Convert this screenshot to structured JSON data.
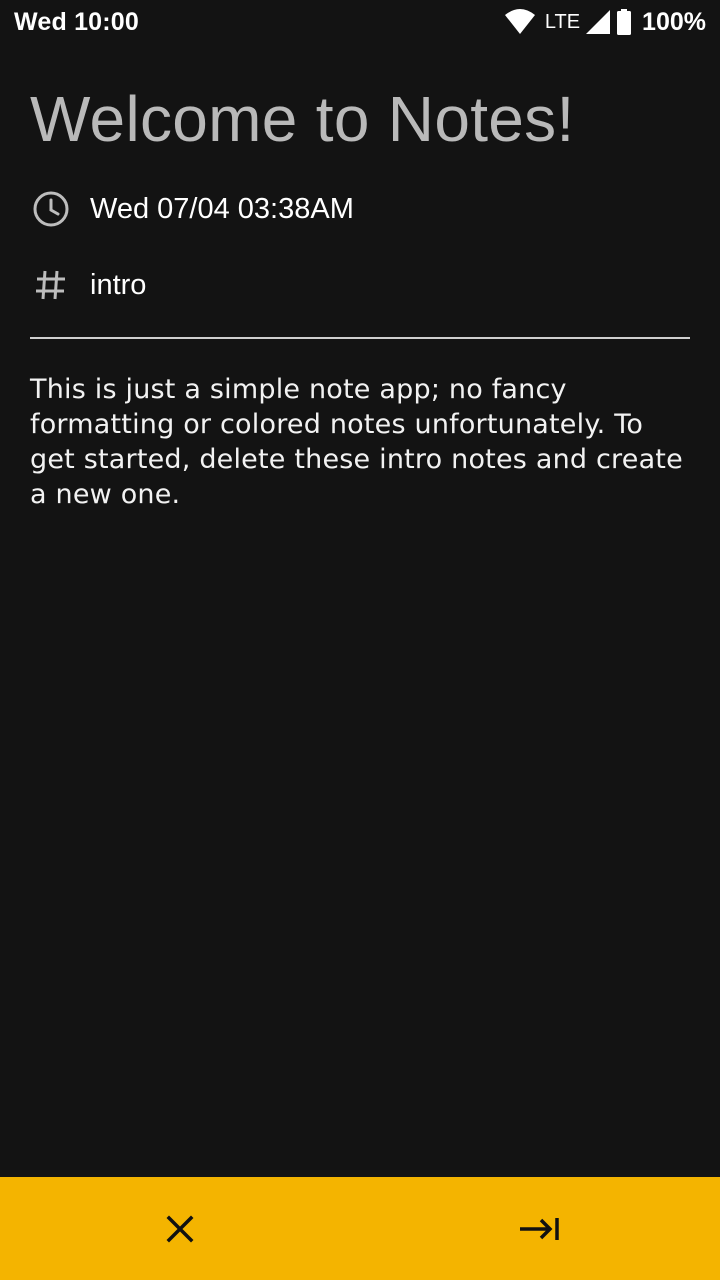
{
  "status_bar": {
    "time": "Wed 10:00",
    "network": "LTE",
    "battery": "100%",
    "icons": [
      "wifi-icon",
      "cell-signal-icon",
      "battery-icon"
    ]
  },
  "note": {
    "title": "Welcome to Notes!",
    "date": "Wed 07/04 03:38AM",
    "tag": "intro",
    "body": "This is just a simple note app; no fancy formatting or colored notes unfortunately. To get started, delete these intro notes and create a new one."
  },
  "bottom_bar": {
    "accent_color": "#f4b400",
    "buttons": [
      {
        "icon": "close-icon"
      },
      {
        "icon": "arrow-to-end-icon"
      }
    ]
  },
  "colors": {
    "background": "#131313",
    "title": "#b9b9b9",
    "text": "#ffffff"
  }
}
